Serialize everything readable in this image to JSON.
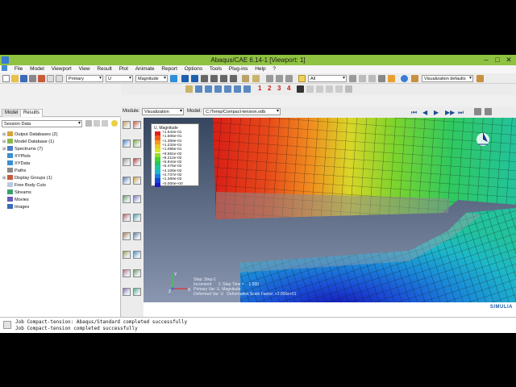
{
  "window": {
    "title": "Abaqus/CAE 6.14-1 [Viewport: 1]",
    "controls": [
      "–",
      "□",
      "✕"
    ]
  },
  "menu": [
    "File",
    "Model",
    "Viewport",
    "View",
    "Result",
    "Plot",
    "Animate",
    "Report",
    "Options",
    "Tools",
    "Plug-ins",
    "Help",
    "?"
  ],
  "toolbar": {
    "step_combo": "Primary",
    "variable_combo": "U",
    "component_combo": "Magnitude",
    "selection_combo": "All",
    "view_defaults_combo": "Visualization defaults",
    "view_numbers": [
      "1",
      "2",
      "3",
      "4"
    ]
  },
  "context": {
    "module_label": "Module:",
    "module_value": "Visualization",
    "model_label": "Model:",
    "model_value": "C:/Temp/Compact-tension.odb"
  },
  "tree": {
    "tabs": [
      "Model",
      "Results"
    ],
    "header": "Session Data",
    "items": [
      {
        "label": "Output Databases (2)",
        "expanded": true,
        "color": "#d8a43a"
      },
      {
        "label": "Model Database (1)",
        "expanded": true,
        "color": "#8bb84a"
      },
      {
        "label": "Spectrums (7)",
        "expanded": true,
        "color": "#4a7bc8"
      },
      {
        "label": "XYPlots",
        "expanded": false,
        "color": "#3a8fd0"
      },
      {
        "label": "XYData",
        "expanded": false,
        "color": "#3a8fd0"
      },
      {
        "label": "Paths",
        "expanded": false,
        "color": "#8a8a8a"
      },
      {
        "label": "Display Groups (1)",
        "expanded": true,
        "color": "#c85a3a"
      },
      {
        "label": "Free Body Cuts",
        "expanded": false,
        "color": "#b9c9e0"
      },
      {
        "label": "Streams",
        "expanded": false,
        "color": "#3aa06a"
      },
      {
        "label": "Movies",
        "expanded": false,
        "color": "#6a5ab8"
      },
      {
        "label": "Images",
        "expanded": false,
        "color": "#3a6ab8"
      }
    ]
  },
  "legend": {
    "title": "U, Magnitude",
    "values": [
      "+1.642e-01",
      "+1.506e-01",
      "+1.369e-01",
      "+1.232e-01",
      "+1.095e-01",
      "+9.581e-02",
      "+8.212e-02",
      "+6.844e-02",
      "+5.475e-02",
      "+4.106e-02",
      "+2.737e-02",
      "+1.369e-02",
      "+0.000e+00"
    ],
    "colors": [
      "#e4201b",
      "#f05a1a",
      "#f49a1e",
      "#ecc621",
      "#d7e52a",
      "#93dd2b",
      "#45d52d",
      "#23c95b",
      "#1fc6a0",
      "#1eb5d1",
      "#1a7be0",
      "#1447d8",
      "#1a1ac6"
    ]
  },
  "viewport_info": {
    "step": "Step: Step-1",
    "increment": "Increment      1: Step Time =    1.000",
    "primary_var": "Primary Var: U, Magnitude",
    "deformed_var": "Deformed Var: U   Deformation Scale Factor: +2.000e+01"
  },
  "triad": {
    "x": "X",
    "y": "Y",
    "z": "Z"
  },
  "brand": "SIMULIA",
  "messages": [
    "Job Compact-tension: Abaqus/Standard completed successfully",
    "Job Compact-tension completed successfully"
  ]
}
